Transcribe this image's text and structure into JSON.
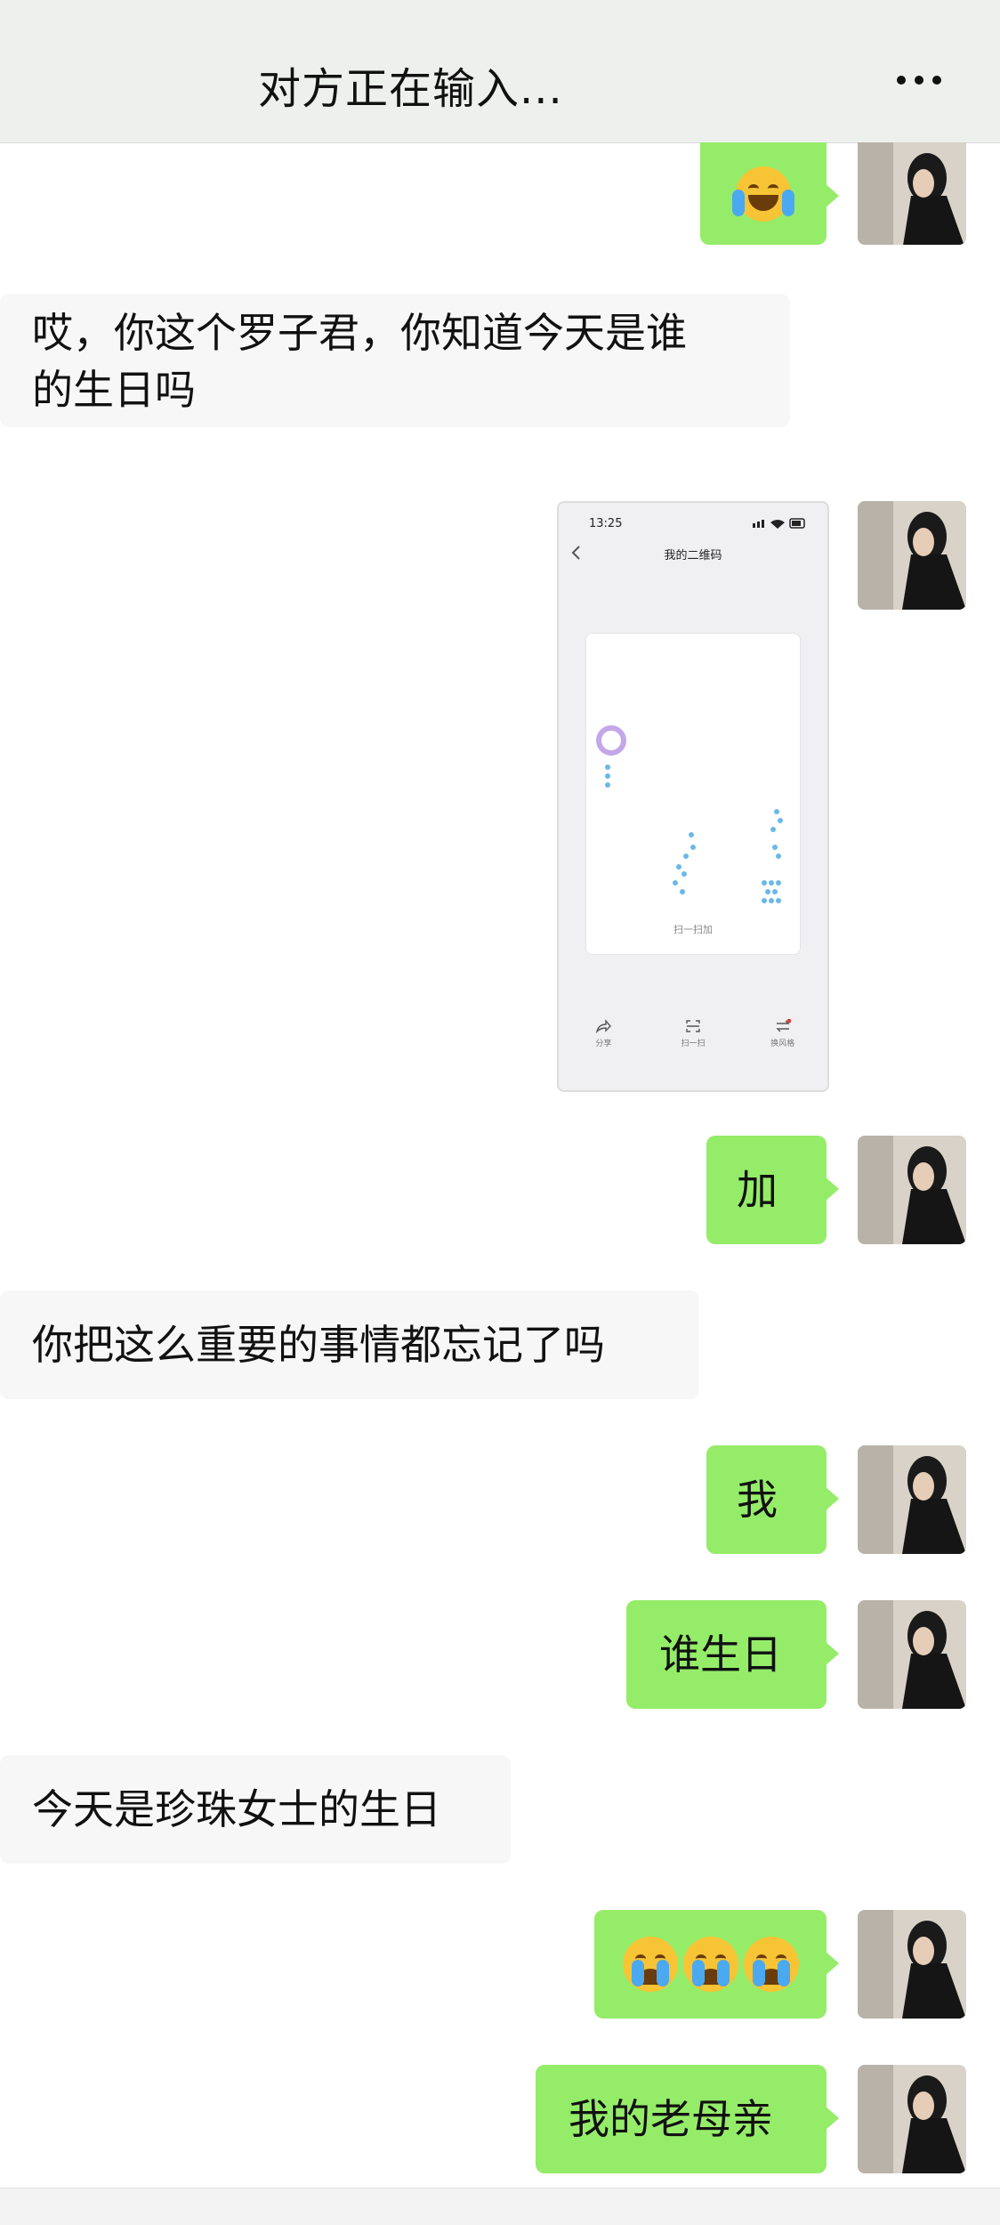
{
  "header": {
    "title": "对方正在输入..."
  },
  "messages": {
    "m2": "哎，你这个罗子君，你知道今天是谁",
    "m2b": "的生日吗",
    "m4": "加",
    "m5": "你把这么重要的事情都忘记了吗",
    "m6": "我",
    "m7": "谁生日",
    "m8": "今天是珍珠女士的生日",
    "m10": "我的老母亲"
  },
  "screenshot": {
    "time": "13:25",
    "title": "我的二维码",
    "caption": "扫一扫加",
    "actions": [
      "分享",
      "扫一扫",
      "换风格"
    ]
  },
  "colors": {
    "bubble_green": "#95ec69",
    "bubble_grey": "#f7f7f7",
    "header_bg": "#eef0ee"
  }
}
